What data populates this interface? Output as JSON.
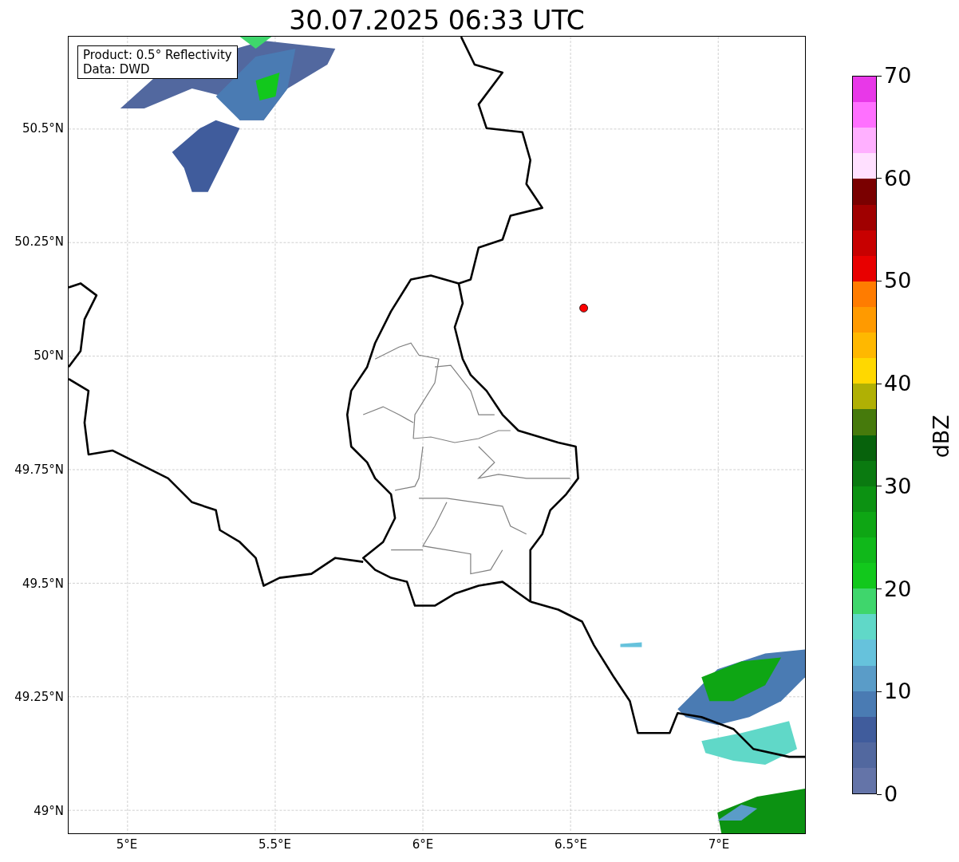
{
  "title": "30.07.2025 06:33 UTC",
  "info_box": [
    "Product: 0.5° Reflectivity",
    "Data: DWD"
  ],
  "y_ticks": [
    "50.5°N",
    "50.25°N",
    "50°N",
    "49.75°N",
    "49.5°N",
    "49.25°N",
    "49°N"
  ],
  "x_ticks": [
    "5°E",
    "5.5°E",
    "6°E",
    "6.5°E",
    "7°E"
  ],
  "colorbar": {
    "label": "dBZ",
    "ticks": [
      "70",
      "60",
      "50",
      "40",
      "30",
      "20",
      "10",
      "0"
    ],
    "bins": [
      {
        "color": "#e838e8"
      },
      {
        "color": "#ff70ff"
      },
      {
        "color": "#ffb0ff"
      },
      {
        "color": "#ffe0ff"
      },
      {
        "color": "#7a0000"
      },
      {
        "color": "#a00000"
      },
      {
        "color": "#c80000"
      },
      {
        "color": "#e80000"
      },
      {
        "color": "#ff7c00"
      },
      {
        "color": "#ff9a00"
      },
      {
        "color": "#ffb800"
      },
      {
        "color": "#ffd800"
      },
      {
        "color": "#b0b004"
      },
      {
        "color": "#467a0c"
      },
      {
        "color": "#07620c"
      },
      {
        "color": "#0a7a10"
      },
      {
        "color": "#0c9212"
      },
      {
        "color": "#0ea614"
      },
      {
        "color": "#10b81a"
      },
      {
        "color": "#12c81c"
      },
      {
        "color": "#3fd66c"
      },
      {
        "color": "#60d8c8"
      },
      {
        "color": "#66c2dc"
      },
      {
        "color": "#5a9cc8"
      },
      {
        "color": "#4a7bb3"
      },
      {
        "color": "#405c9c"
      },
      {
        "color": "#52689f"
      },
      {
        "color": "#6474a8"
      }
    ]
  }
}
